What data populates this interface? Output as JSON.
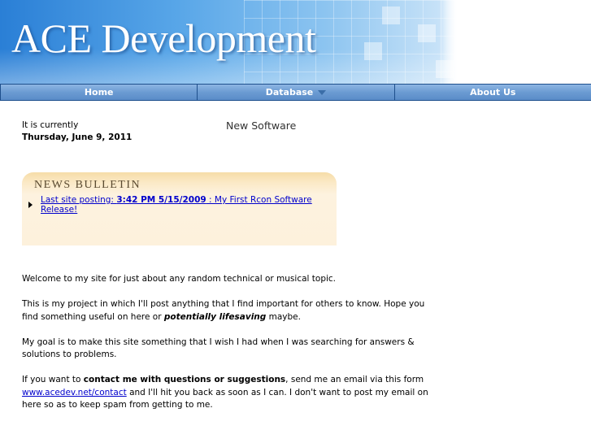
{
  "header": {
    "logo_text": "ACE Development"
  },
  "nav": {
    "items": [
      {
        "label": "Home"
      },
      {
        "label": "Database"
      },
      {
        "label": "About Us"
      }
    ]
  },
  "date": {
    "prefix": "It is currently",
    "value": "Thursday, June 9, 2011"
  },
  "new_software": "New Software",
  "bulletin": {
    "title": "NEWS BULLETIN",
    "link_prefix": "Last site posting: ",
    "link_time": "3:42 PM 5/15/2009",
    "link_suffix": " : My First Rcon Software Release!"
  },
  "content": {
    "p1": "Welcome to my site for just about any random technical or musical topic.",
    "p2_a": "This is my project in which I'll post anything that I find important for others to know. Hope you find something useful on here or ",
    "p2_b": "potentially lifesaving",
    "p2_c": " maybe.",
    "p3": "My goal is to make this site something that I wish I had when I was searching for answers & solutions to problems.",
    "p4_a": "If you want to ",
    "p4_b": "contact me with questions or suggestions",
    "p4_c": ", send me an email via this form ",
    "p4_link": "www.acedev.net/contact",
    "p4_d": " and I'll hit you back as soon as I can. I don't want to post my email on here so as to keep spam from getting to me."
  },
  "colors": {
    "nav": "#6a9bd0",
    "link": "#0000cc",
    "bulletin": "#fbe9c6"
  }
}
